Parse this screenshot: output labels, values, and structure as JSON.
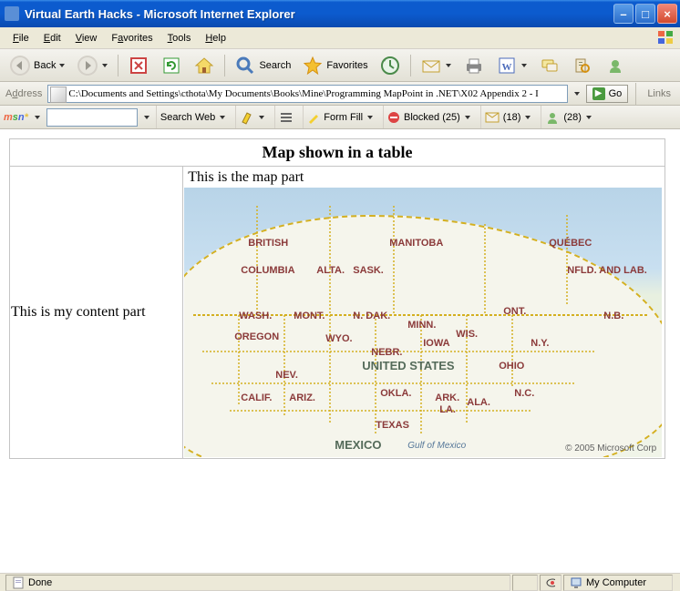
{
  "window": {
    "title": "Virtual Earth Hacks - Microsoft Internet Explorer"
  },
  "menu": {
    "file": "File",
    "edit": "Edit",
    "view": "View",
    "favorites": "Favorites",
    "tools": "Tools",
    "help": "Help"
  },
  "toolbar": {
    "back": "Back",
    "search": "Search",
    "favorites": "Favorites"
  },
  "address": {
    "label": "Address",
    "path": "C:\\Documents and Settings\\cthota\\My Documents\\Books\\Mine\\Programming MapPoint in .NET\\X02 Appendix 2 - I",
    "go": "Go",
    "links": "Links"
  },
  "msn": {
    "search_web": "Search Web",
    "form_fill": "Form Fill",
    "blocked": "Blocked (25)",
    "mail_count": "(18)",
    "buddy_count": "(28)"
  },
  "page": {
    "heading": "Map shown in a table",
    "left_cell": "This is my content part",
    "right_cell_label": "This is the map part",
    "map_copyright": "© 2005 Microsoft Corp",
    "gulf_label": "Gulf of Mexico",
    "country_us": "UNITED STATES",
    "country_mexico": "MEXICO",
    "region_labels": {
      "british": "BRITISH",
      "columbia": "COLUMBIA",
      "alta": "ALTA.",
      "sask": "SASK.",
      "manitoba": "MANITOBA",
      "ont": "ONT.",
      "quebec": "QUÉBEC",
      "nfld": "NFLD. AND LAB.",
      "nb": "N.B.",
      "wash": "WASH.",
      "mont": "MONT.",
      "ndak": "N. DAK.",
      "minn": "MINN.",
      "oregon": "OREGON",
      "wyo": "WYO.",
      "nebr": "NEBR.",
      "iowa": "IOWA",
      "wis": "WIS.",
      "ny": "N.Y.",
      "nev": "NEV.",
      "calif": "CALIF.",
      "ariz": "ARIZ.",
      "okla": "OKLA.",
      "texas": "TEXAS",
      "ark": "ARK.",
      "la": "LA.",
      "ala": "ALA.",
      "nc": "N.C.",
      "ohio": "OHIO"
    }
  },
  "status": {
    "done": "Done",
    "zone": "My Computer"
  }
}
